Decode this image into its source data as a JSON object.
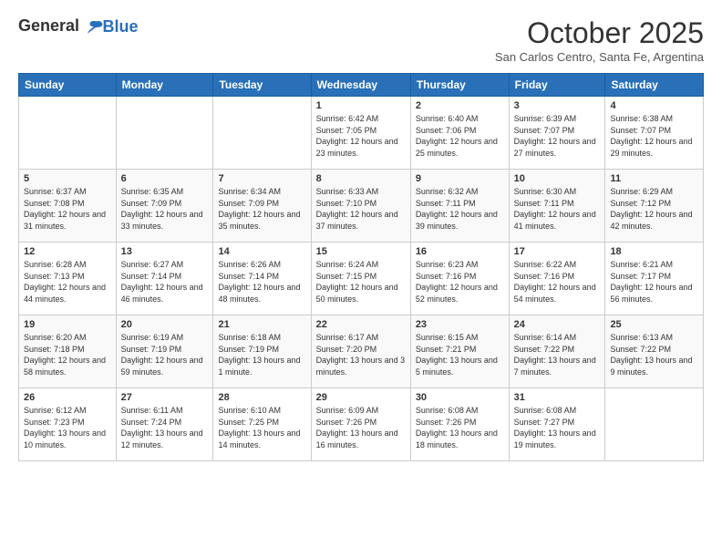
{
  "logo": {
    "general": "General",
    "blue": "Blue"
  },
  "title": "October 2025",
  "subtitle": "San Carlos Centro, Santa Fe, Argentina",
  "days_of_week": [
    "Sunday",
    "Monday",
    "Tuesday",
    "Wednesday",
    "Thursday",
    "Friday",
    "Saturday"
  ],
  "weeks": [
    [
      {
        "day": "",
        "info": ""
      },
      {
        "day": "",
        "info": ""
      },
      {
        "day": "",
        "info": ""
      },
      {
        "day": "1",
        "info": "Sunrise: 6:42 AM\nSunset: 7:05 PM\nDaylight: 12 hours and 23 minutes."
      },
      {
        "day": "2",
        "info": "Sunrise: 6:40 AM\nSunset: 7:06 PM\nDaylight: 12 hours and 25 minutes."
      },
      {
        "day": "3",
        "info": "Sunrise: 6:39 AM\nSunset: 7:07 PM\nDaylight: 12 hours and 27 minutes."
      },
      {
        "day": "4",
        "info": "Sunrise: 6:38 AM\nSunset: 7:07 PM\nDaylight: 12 hours and 29 minutes."
      }
    ],
    [
      {
        "day": "5",
        "info": "Sunrise: 6:37 AM\nSunset: 7:08 PM\nDaylight: 12 hours and 31 minutes."
      },
      {
        "day": "6",
        "info": "Sunrise: 6:35 AM\nSunset: 7:09 PM\nDaylight: 12 hours and 33 minutes."
      },
      {
        "day": "7",
        "info": "Sunrise: 6:34 AM\nSunset: 7:09 PM\nDaylight: 12 hours and 35 minutes."
      },
      {
        "day": "8",
        "info": "Sunrise: 6:33 AM\nSunset: 7:10 PM\nDaylight: 12 hours and 37 minutes."
      },
      {
        "day": "9",
        "info": "Sunrise: 6:32 AM\nSunset: 7:11 PM\nDaylight: 12 hours and 39 minutes."
      },
      {
        "day": "10",
        "info": "Sunrise: 6:30 AM\nSunset: 7:11 PM\nDaylight: 12 hours and 41 minutes."
      },
      {
        "day": "11",
        "info": "Sunrise: 6:29 AM\nSunset: 7:12 PM\nDaylight: 12 hours and 42 minutes."
      }
    ],
    [
      {
        "day": "12",
        "info": "Sunrise: 6:28 AM\nSunset: 7:13 PM\nDaylight: 12 hours and 44 minutes."
      },
      {
        "day": "13",
        "info": "Sunrise: 6:27 AM\nSunset: 7:14 PM\nDaylight: 12 hours and 46 minutes."
      },
      {
        "day": "14",
        "info": "Sunrise: 6:26 AM\nSunset: 7:14 PM\nDaylight: 12 hours and 48 minutes."
      },
      {
        "day": "15",
        "info": "Sunrise: 6:24 AM\nSunset: 7:15 PM\nDaylight: 12 hours and 50 minutes."
      },
      {
        "day": "16",
        "info": "Sunrise: 6:23 AM\nSunset: 7:16 PM\nDaylight: 12 hours and 52 minutes."
      },
      {
        "day": "17",
        "info": "Sunrise: 6:22 AM\nSunset: 7:16 PM\nDaylight: 12 hours and 54 minutes."
      },
      {
        "day": "18",
        "info": "Sunrise: 6:21 AM\nSunset: 7:17 PM\nDaylight: 12 hours and 56 minutes."
      }
    ],
    [
      {
        "day": "19",
        "info": "Sunrise: 6:20 AM\nSunset: 7:18 PM\nDaylight: 12 hours and 58 minutes."
      },
      {
        "day": "20",
        "info": "Sunrise: 6:19 AM\nSunset: 7:19 PM\nDaylight: 12 hours and 59 minutes."
      },
      {
        "day": "21",
        "info": "Sunrise: 6:18 AM\nSunset: 7:19 PM\nDaylight: 13 hours and 1 minute."
      },
      {
        "day": "22",
        "info": "Sunrise: 6:17 AM\nSunset: 7:20 PM\nDaylight: 13 hours and 3 minutes."
      },
      {
        "day": "23",
        "info": "Sunrise: 6:15 AM\nSunset: 7:21 PM\nDaylight: 13 hours and 5 minutes."
      },
      {
        "day": "24",
        "info": "Sunrise: 6:14 AM\nSunset: 7:22 PM\nDaylight: 13 hours and 7 minutes."
      },
      {
        "day": "25",
        "info": "Sunrise: 6:13 AM\nSunset: 7:22 PM\nDaylight: 13 hours and 9 minutes."
      }
    ],
    [
      {
        "day": "26",
        "info": "Sunrise: 6:12 AM\nSunset: 7:23 PM\nDaylight: 13 hours and 10 minutes."
      },
      {
        "day": "27",
        "info": "Sunrise: 6:11 AM\nSunset: 7:24 PM\nDaylight: 13 hours and 12 minutes."
      },
      {
        "day": "28",
        "info": "Sunrise: 6:10 AM\nSunset: 7:25 PM\nDaylight: 13 hours and 14 minutes."
      },
      {
        "day": "29",
        "info": "Sunrise: 6:09 AM\nSunset: 7:26 PM\nDaylight: 13 hours and 16 minutes."
      },
      {
        "day": "30",
        "info": "Sunrise: 6:08 AM\nSunset: 7:26 PM\nDaylight: 13 hours and 18 minutes."
      },
      {
        "day": "31",
        "info": "Sunrise: 6:08 AM\nSunset: 7:27 PM\nDaylight: 13 hours and 19 minutes."
      },
      {
        "day": "",
        "info": ""
      }
    ]
  ]
}
